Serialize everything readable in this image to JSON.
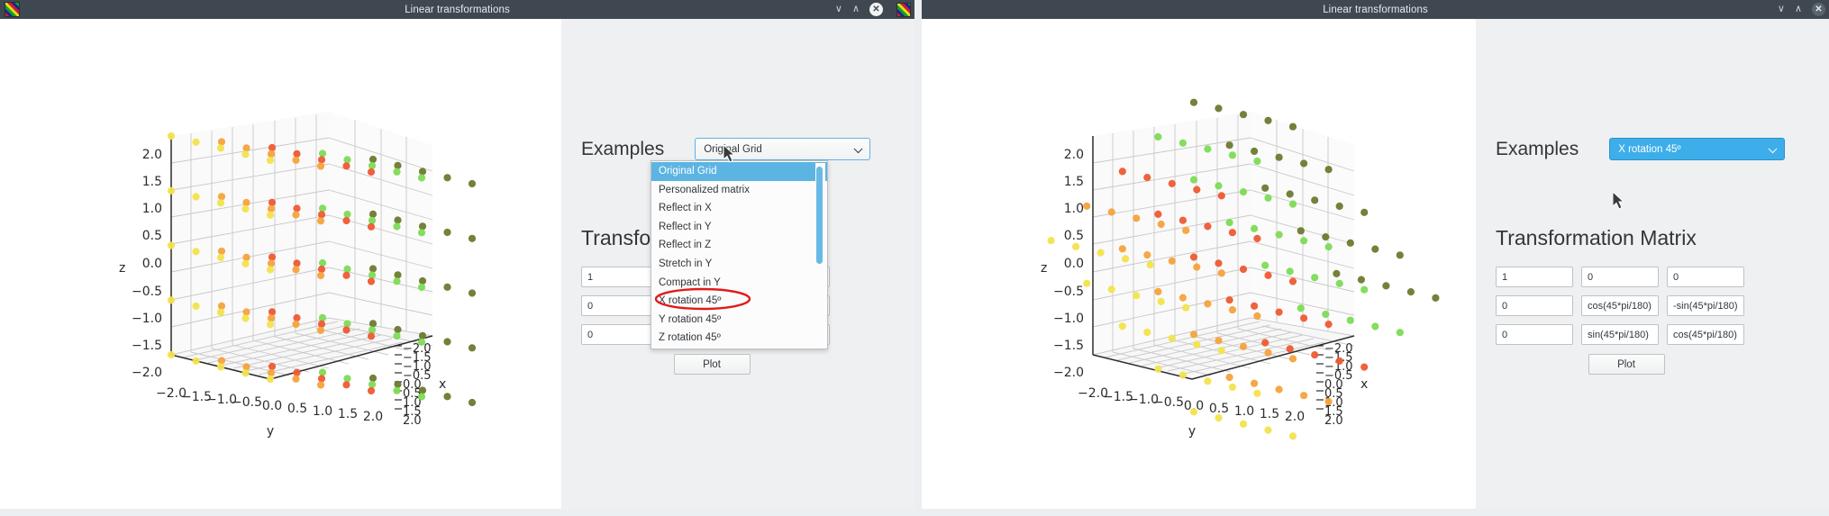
{
  "app": {
    "window_title": "Linear transformations"
  },
  "titlebar": {
    "minimize_glyph": "∨",
    "maximize_glyph": "∧",
    "close_glyph": "✕"
  },
  "left_window": {
    "examples_label": "Examples",
    "combo_value": "Original Grid",
    "matrix_title": "Transformation Matrix",
    "plot_label": "Plot",
    "matrix": [
      [
        "1",
        "",
        ""
      ],
      [
        "0",
        "",
        ""
      ],
      [
        "0",
        "",
        ""
      ]
    ],
    "dropdown": {
      "open": true,
      "selected_index": 0,
      "annotated_index": 7,
      "options": [
        "Original Grid",
        "Personalized matrix",
        "Reflect in X",
        "Reflect in Y",
        "Reflect in Z",
        "Stretch in Y",
        "Compact in Y",
        "X rotation 45º",
        "Y rotation 45º",
        "Z rotation 45º"
      ]
    }
  },
  "right_window": {
    "examples_label": "Examples",
    "combo_value": "X rotation 45º",
    "matrix_title": "Transformation Matrix",
    "plot_label": "Plot",
    "matrix": [
      [
        "1",
        "0",
        "0"
      ],
      [
        "0",
        "cos(45*pi/180)",
        "-sin(45*pi/180)"
      ],
      [
        "0",
        "sin(45*pi/180)",
        "cos(45*pi/180)"
      ]
    ]
  },
  "colors": {
    "titlebar": "#3f4850",
    "panel_bg": "#eff0f1",
    "accent_blue": "#3daee9",
    "highlight_blue": "#5cb4e3",
    "annotation_red": "#e01b1b",
    "plot_bg": "#ffffff"
  },
  "chart_data": [
    {
      "id": "left-plot",
      "type": "scatter",
      "title": "",
      "xlabel": "y",
      "ylabel": "z",
      "zlabel": "x",
      "projection": "3d",
      "grid": true,
      "z_ticks": [
        "2.0",
        "1.5",
        "1.0",
        "0.5",
        "0.0",
        "-0.5",
        "-1.0",
        "-1.5",
        "-2.0"
      ],
      "y_ticks": [
        "-2.0",
        "-1.5",
        "-1.0",
        "-0.5",
        "0.0",
        "0.5",
        "1.0",
        "1.5",
        "2.0"
      ],
      "x_ticks": [
        "-2.0",
        "-1.5",
        "-1.0",
        "-0.5",
        "0.0",
        "0.5",
        "1.0",
        "1.5",
        "2.0"
      ],
      "xlim": [
        -2,
        2
      ],
      "ylim": [
        -2,
        2
      ],
      "zlim": [
        -2,
        2
      ],
      "description": "Untransformed cubic lattice of points spanning -2..2 in x, y and z, colored by position along a yellow-orange-red-green colormap",
      "lattice": {
        "x": [
          -2,
          -1,
          0,
          1,
          2
        ],
        "y": [
          -2,
          -1,
          0,
          1,
          2
        ],
        "z": [
          -2,
          -1,
          0,
          1,
          2
        ]
      },
      "transform_matrix": [
        [
          1,
          0,
          0
        ],
        [
          0,
          1,
          0
        ],
        [
          0,
          0,
          1
        ]
      ],
      "point_colors": [
        "#f4e04a",
        "#f6a03c",
        "#ef5b35",
        "#7ed957",
        "#6d7a2e"
      ]
    },
    {
      "id": "right-plot",
      "type": "scatter",
      "title": "",
      "xlabel": "y",
      "ylabel": "z",
      "zlabel": "x",
      "projection": "3d",
      "grid": true,
      "z_ticks": [
        "2.0",
        "1.5",
        "1.0",
        "0.5",
        "0.0",
        "-0.5",
        "-1.0",
        "-1.5",
        "-2.0"
      ],
      "y_ticks": [
        "-2.0",
        "-1.5",
        "-1.0",
        "-0.5",
        "0.0",
        "0.5",
        "1.0",
        "1.5",
        "2.0"
      ],
      "x_ticks": [
        "-2.0",
        "-1.5",
        "-1.0",
        "-0.5",
        "0.0",
        "0.5",
        "1.0",
        "1.5",
        "2.0"
      ],
      "xlim": [
        -2,
        2
      ],
      "ylim": [
        -2,
        2
      ],
      "zlim": [
        -2,
        2
      ],
      "description": "Same lattice after a 45 degree rotation about the X axis; point rows are sheared diagonally and extend past the axis box",
      "lattice": {
        "x": [
          -2,
          -1,
          0,
          1,
          2
        ],
        "y": [
          -2,
          -1,
          0,
          1,
          2
        ],
        "z": [
          -2,
          -1,
          0,
          1,
          2
        ]
      },
      "transform_matrix": [
        [
          1,
          0,
          0
        ],
        [
          0,
          0.70710678,
          -0.70710678
        ],
        [
          0,
          0.70710678,
          0.70710678
        ]
      ],
      "point_colors": [
        "#f4e04a",
        "#f6a03c",
        "#ef5b35",
        "#7ed957",
        "#6d7a2e"
      ]
    }
  ]
}
